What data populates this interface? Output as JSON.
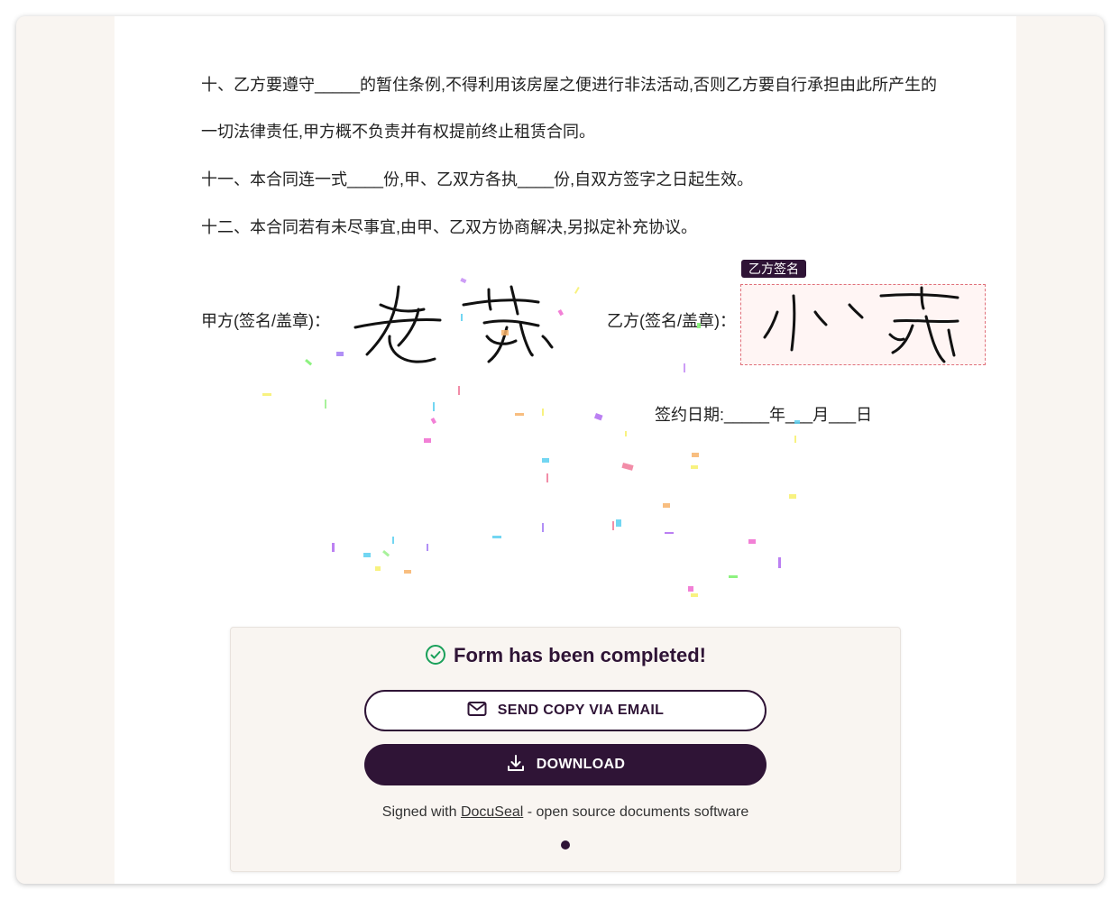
{
  "document": {
    "clauses": [
      "十、乙方要遵守_____的暂住条例,不得利用该房屋之便进行非法活动,否则乙方要自行承担由此所产生的",
      "一切法律责任,甲方概不负责并有权提前终止租赁合同。",
      "十一、本合同连一式____份,甲、乙双方各执____份,自双方签字之日起生效。",
      "十二、本合同若有未尽事宜,由甲、乙双方协商解决,另拟定补充协议。"
    ],
    "party_a_label": "甲方(签名/盖章)：",
    "party_b_label": "乙方(签名/盖章)：",
    "party_b_tag": "乙方签名",
    "date_line": "签约日期:_____年___月___日"
  },
  "completion_panel": {
    "status_text": "Form has been completed!",
    "email_button_label": "SEND COPY VIA EMAIL",
    "download_button_label": "DOWNLOAD",
    "footer_prefix": "Signed with ",
    "footer_link": "DocuSeal",
    "footer_suffix": " - open source documents software"
  },
  "colors": {
    "brand": "#2f1436",
    "success": "#1aa05a",
    "signature_field_border": "#e0707a"
  },
  "icons": {
    "status": "check-circle-icon",
    "email": "envelope-icon",
    "download": "download-icon"
  }
}
